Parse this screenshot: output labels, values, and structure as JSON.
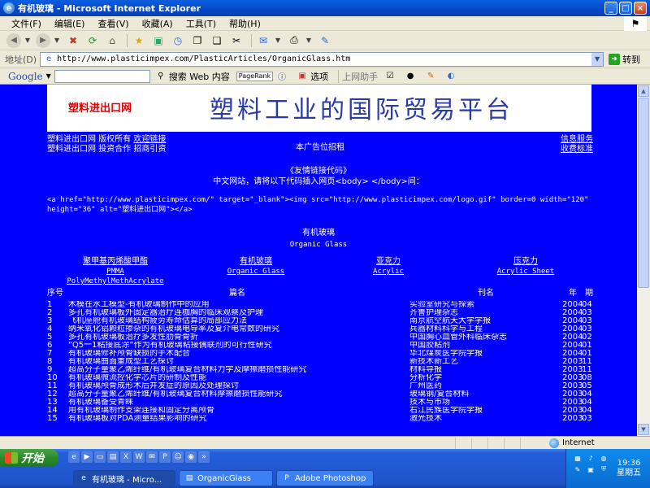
{
  "window": {
    "title": "有机玻璃 - Microsoft Internet Explorer",
    "ie_icon": "e",
    "minimize": "_",
    "maximize": "□",
    "close": "×"
  },
  "menu": [
    "文件(F)",
    "编辑(E)",
    "查看(V)",
    "收藏(A)",
    "工具(T)",
    "帮助(H)"
  ],
  "address": {
    "label": "地址(D)",
    "url": "http://www.plasticimpex.com/PlasticArticles/OrganicGlass.htm",
    "go": "转到"
  },
  "google_bar": {
    "logo": "Google",
    "search": "搜索 Web 内容",
    "pagerank": "PageRank",
    "options": "选项",
    "helper": "上网助手"
  },
  "page": {
    "banner_brand": "塑料进出口网",
    "banner_slogan": "塑料工业的国际贸易平台",
    "top_links": {
      "line1": [
        "塑料进出口网",
        "版权所有",
        "欢迎链接"
      ],
      "line2": [
        "塑料进出口网",
        "投资合作",
        "招商引资"
      ]
    },
    "ad_text": "本广告位招租",
    "right_links": [
      "信息服务",
      "收费标准"
    ],
    "friend_title": "《友情链接代码》",
    "friend_desc": "中文网站，请将以下代码插入网页<body> </body>间：",
    "code_snippet": "<a href=\"http://www.plasticimpex.com/\" target=\"_blank\"><img src=\"http://www.plasticimpex.com/logo.gif\" border=0 width=\"120\" height=\"36\" alt=\"塑料进出口网\"></a>",
    "title_zh": "有机玻璃",
    "title_en": "Organic Glass",
    "categories": [
      {
        "zh": "聚甲基丙烯酸甲酯",
        "en": "PMMA PolyMethylMethAcrylate"
      },
      {
        "zh": "有机玻璃",
        "en": "Organic Glass"
      },
      {
        "zh": "亚克力",
        "en": "Acrylic"
      },
      {
        "zh": "压克力",
        "en": "Acrylic Sheet"
      }
    ],
    "table_headers": {
      "no": "序号",
      "title": "篇名",
      "journal": "刊名",
      "year": "年",
      "issue": "期"
    },
    "rows": [
      {
        "no": "1",
        "title": "木模在水工模型-有机玻璃制作中的应用",
        "journal": "实验室研究与探索",
        "year": "2004",
        "issue": "04"
      },
      {
        "no": "2",
        "title": "多孔有机玻璃板外固定器治疗连枷胸的临床观察及护理",
        "journal": "齐鲁护理杂志",
        "year": "2004",
        "issue": "03"
      },
      {
        "no": "3",
        "title": "飞机座舱有机玻璃结构疲劳寿命估算的局部应力法",
        "journal": "南京航空航天大学学报",
        "year": "2004",
        "issue": "03"
      },
      {
        "no": "4",
        "title": "纳米氧化铝颗粒掺杂的有机玻璃电导率及复介电常数的研究",
        "journal": "兵器材料科学与工程",
        "year": "2004",
        "issue": "03"
      },
      {
        "no": "5",
        "title": "多孔有机玻璃板治疗多发性肋骨骨折",
        "journal": "中国胸心血管外科临床杂志",
        "year": "2004",
        "issue": "02"
      },
      {
        "no": "6",
        "title": "“Q5一1粘接底涂”作为有机玻璃粘接偶联剂的可行性研究",
        "journal": "中国胶粘剂",
        "year": "2004",
        "issue": "01"
      },
      {
        "no": "7",
        "title": "有机玻璃修补颅骨缺损的手术配合",
        "journal": "华北煤炭医学院学报",
        "year": "2004",
        "issue": "01"
      },
      {
        "no": "8",
        "title": "有机玻璃曲面重成型工艺探讨",
        "journal": "新技术新工艺",
        "year": "2003",
        "issue": "11"
      },
      {
        "no": "9",
        "title": "超高分子量聚乙烯纤维/有机玻璃复合材料力学及摩擦磨损性能研究",
        "journal": "材料导报",
        "year": "2003",
        "issue": "11"
      },
      {
        "no": "10",
        "title": "有机玻璃微流控化学芯片的研制及性能",
        "journal": "分析化学",
        "year": "2003",
        "issue": "08"
      },
      {
        "no": "11",
        "title": "有机玻璃颅骨成形术后并发症的原因及处理探讨",
        "journal": "广州医药",
        "year": "2003",
        "issue": "05"
      },
      {
        "no": "12",
        "title": "超高分子量聚乙烯纤维/有机玻璃复合材料摩擦磨损性能研究",
        "journal": "玻璃钢/复合材料",
        "year": "2003",
        "issue": "04"
      },
      {
        "no": "13",
        "title": "有机玻璃备受青睐",
        "journal": "技术与市场",
        "year": "2003",
        "issue": "04"
      },
      {
        "no": "14",
        "title": "用有机玻璃制作支架连接和固定分离颅骨",
        "journal": "右江民族医学院学报",
        "year": "2003",
        "issue": "04"
      },
      {
        "no": "15",
        "title": "有机玻璃板对PDA测量结果影响的研究",
        "journal": "激光技术",
        "year": "2003",
        "issue": "03"
      }
    ]
  },
  "status": {
    "zone": "Internet"
  },
  "taskbar": {
    "start": "开始",
    "tasks": [
      "有机玻璃 - Micro...",
      "OrganicGlass",
      "Adobe Photoshop"
    ],
    "time": "19:36",
    "day": "星期五"
  },
  "colors": {
    "page_bg": "#0000ff",
    "slogan": "#2a3aa8",
    "brand": "#e00000"
  }
}
